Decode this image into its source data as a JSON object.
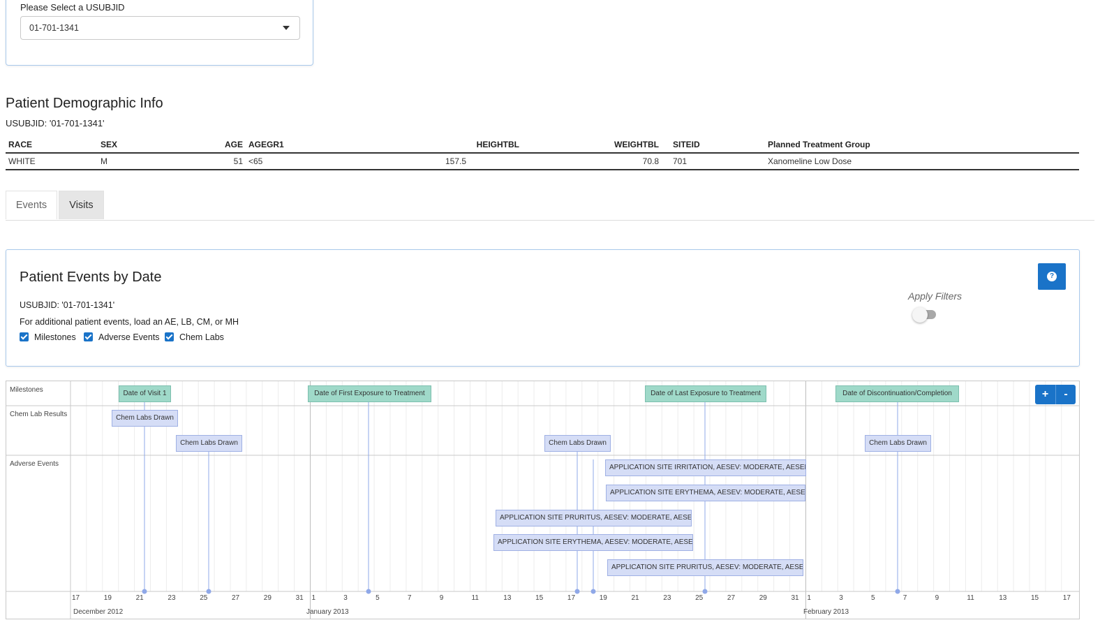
{
  "selector": {
    "label": "Please Select a USUBJID",
    "value": "01-701-1341"
  },
  "demographics": {
    "title": "Patient Demographic Info",
    "usubjid_line": "USUBJID: '01-701-1341'",
    "columns": [
      "RACE",
      "SEX",
      "AGE",
      "AGEGR1",
      "HEIGHTBL",
      "WEIGHTBL",
      "SITEID",
      "Planned Treatment Group"
    ],
    "row": [
      "WHITE",
      "M",
      "51",
      "<65",
      "157.5",
      "70.8",
      "701",
      "Xanomeline Low Dose"
    ]
  },
  "tabs": [
    {
      "label": "Events",
      "active": true
    },
    {
      "label": "Visits",
      "active": false
    }
  ],
  "events_panel": {
    "title": "Patient Events by Date",
    "usubjid_line": "USUBJID: '01-701-1341'",
    "note": "For additional patient events, load an AE, LB, CM, or MH",
    "checkboxes": [
      {
        "label": "Milestones",
        "checked": true
      },
      {
        "label": "Adverse Events",
        "checked": true
      },
      {
        "label": "Chem Labs",
        "checked": true
      }
    ],
    "help_icon": "question-circle-icon",
    "filter_label": "Apply Filters",
    "filter_on": false,
    "accent_color": "#1a73c8"
  },
  "timeline": {
    "groups": [
      "Milestones",
      "Chem Lab Results",
      "Adverse Events"
    ],
    "zoom_in_label": "+",
    "zoom_out_label": "-",
    "items": [
      {
        "group": "Milestones",
        "label": "Date of Visit 1",
        "date": "2012-12-22"
      },
      {
        "group": "Milestones",
        "label": "Date of First Exposure to Treatment",
        "date": "2013-01-04"
      },
      {
        "group": "Milestones",
        "label": "Date of Last Exposure to Treatment",
        "date": "2013-01-25"
      },
      {
        "group": "Milestones",
        "label": "Date of Discontinuation/Completion",
        "date": "2013-02-06"
      },
      {
        "group": "Chem Lab Results",
        "label": "Chem Labs Drawn",
        "date": "2012-12-22"
      },
      {
        "group": "Chem Lab Results",
        "label": "Chem Labs Drawn",
        "date": "2012-12-26"
      },
      {
        "group": "Chem Lab Results",
        "label": "Chem Labs Drawn",
        "date": "2013-01-17"
      },
      {
        "group": "Chem Lab Results",
        "label": "Chem Labs Drawn",
        "date": "2013-02-06"
      },
      {
        "group": "Adverse Events",
        "label": "APPLICATION SITE IRRITATION, AESEV: MODERATE, AESER: N"
      },
      {
        "group": "Adverse Events",
        "label": "APPLICATION SITE ERYTHEMA, AESEV: MODERATE, AESER: N"
      },
      {
        "group": "Adverse Events",
        "label": "APPLICATION SITE PRURITUS, AESEV: MODERATE, AESER: N"
      },
      {
        "group": "Adverse Events",
        "label": "APPLICATION SITE ERYTHEMA, AESEV: MODERATE, AESER: N"
      },
      {
        "group": "Adverse Events",
        "label": "APPLICATION SITE PRURITUS, AESEV: MODERATE, AESER: N"
      }
    ],
    "ticks": [
      "17",
      "19",
      "21",
      "23",
      "25",
      "27",
      "29",
      "31",
      "1",
      "3",
      "5",
      "7",
      "9",
      "11",
      "13",
      "15",
      "17",
      "19",
      "21",
      "23",
      "25",
      "27",
      "29",
      "31",
      "1",
      "3",
      "5",
      "7",
      "9",
      "11",
      "13",
      "15",
      "17"
    ],
    "months": [
      "December 2012",
      "January 2013",
      "February 2013"
    ]
  }
}
